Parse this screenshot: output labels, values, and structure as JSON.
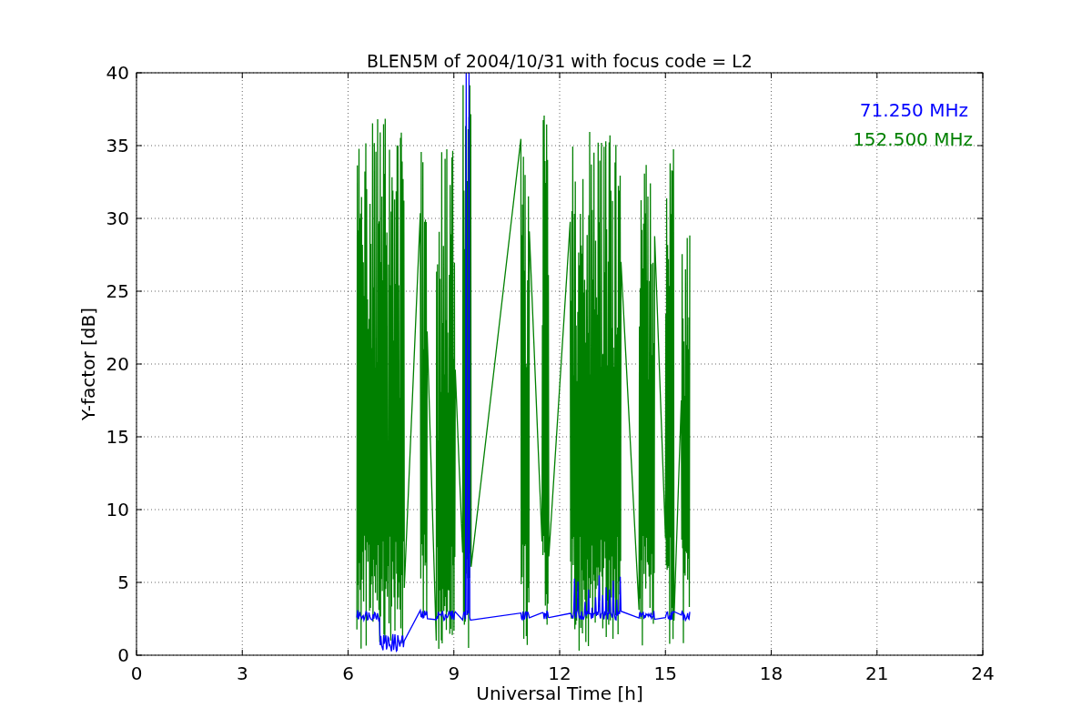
{
  "plot": {
    "title": "BLEN5M of 2004/10/31 with focus code = L2",
    "xlabel": "Universal Time [h]",
    "ylabel": "Y-factor [dB]",
    "xticks": [
      "0",
      "3",
      "6",
      "9",
      "12",
      "15",
      "18",
      "21",
      "24"
    ],
    "yticks": [
      "40",
      "35",
      "30",
      "25",
      "20",
      "15",
      "10",
      "5",
      "0"
    ],
    "legend": [
      {
        "label": "71.250 MHz",
        "color": "#0000ff",
        "kind": "baseline"
      },
      {
        "label": "152.500 MHz",
        "color": "#008000",
        "kind": "bursts"
      }
    ]
  }
}
